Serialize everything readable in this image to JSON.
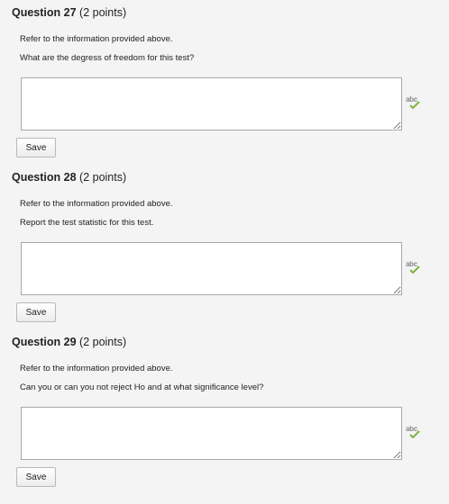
{
  "questions": [
    {
      "number_label": "Question 27",
      "points": "(2 points)",
      "line1": "Refer to the information provided above.",
      "line2": "What are the degress of freedom for this test?",
      "answer": "",
      "save_label": "Save",
      "spell_icon_text": "abc"
    },
    {
      "number_label": "Question 28",
      "points": "(2 points)",
      "line1": "Refer to the information provided above.",
      "line2": "Report the test statistic for this test.",
      "answer": "",
      "save_label": "Save",
      "spell_icon_text": "abc"
    },
    {
      "number_label": "Question 29",
      "points": "(2 points)",
      "line1": "Refer to the information provided above.",
      "line2": "Can you or can you not reject Ho and at what significance level?",
      "answer": "",
      "save_label": "Save",
      "spell_icon_text": "abc"
    }
  ],
  "colors": {
    "background": "#f4f4f4",
    "text": "#222222",
    "spell_check": "#7cb342",
    "border": "#a8a8a8"
  }
}
